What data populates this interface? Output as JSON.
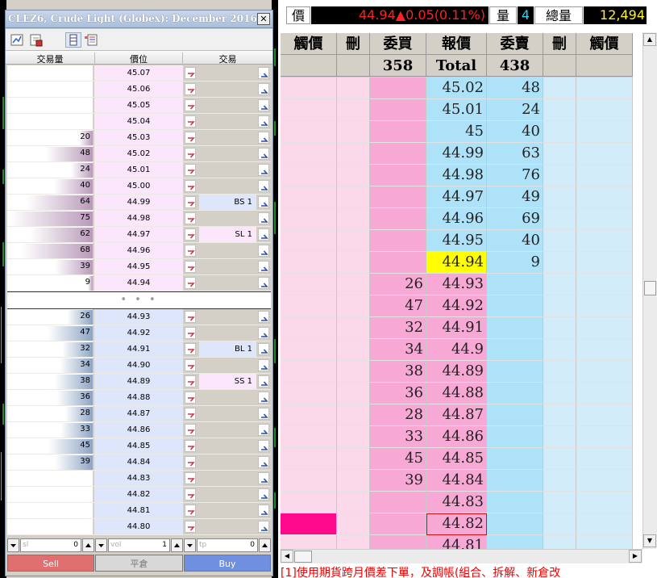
{
  "window": {
    "title": "CLEZ6, Crude Light (Globex): December 2016",
    "close_glyph": "✕"
  },
  "toolbar": {
    "icons": [
      "chart-icon",
      "depth-icon",
      "ladder-icon",
      "settings-list-icon"
    ],
    "active": "ladder-icon"
  },
  "columns": {
    "volume": "交易量",
    "price": "價位",
    "trade": "交易"
  },
  "ask_rows": [
    {
      "price": "45.07",
      "volume": "",
      "volume_bar": 0,
      "trade": ""
    },
    {
      "price": "45.06",
      "volume": "",
      "volume_bar": 0,
      "trade": ""
    },
    {
      "price": "45.05",
      "volume": "",
      "volume_bar": 0,
      "trade": ""
    },
    {
      "price": "45.04",
      "volume": "",
      "volume_bar": 0,
      "trade": ""
    },
    {
      "price": "45.03",
      "volume": "20",
      "volume_bar": 0.16,
      "trade": ""
    },
    {
      "price": "45.02",
      "volume": "48",
      "volume_bar": 0.55,
      "trade": ""
    },
    {
      "price": "45.01",
      "volume": "24",
      "volume_bar": 0.25,
      "trade": ""
    },
    {
      "price": "45.00",
      "volume": "40",
      "volume_bar": 0.45,
      "trade": ""
    },
    {
      "price": "44.99",
      "volume": "64",
      "volume_bar": 0.77,
      "trade": "BS 1"
    },
    {
      "price": "44.98",
      "volume": "75",
      "volume_bar": 0.96,
      "trade": ""
    },
    {
      "price": "44.97",
      "volume": "62",
      "volume_bar": 0.74,
      "trade": "SL 1"
    },
    {
      "price": "44.96",
      "volume": "68",
      "volume_bar": 0.83,
      "trade": ""
    },
    {
      "price": "44.95",
      "volume": "39",
      "volume_bar": 0.44,
      "trade": ""
    },
    {
      "price": "44.94",
      "volume": "9",
      "volume_bar": 0.06,
      "trade": ""
    }
  ],
  "separator": "• • •",
  "bid_rows": [
    {
      "price": "44.93",
      "volume": "26",
      "volume_bar": 0.3,
      "trade": ""
    },
    {
      "price": "44.92",
      "volume": "47",
      "volume_bar": 0.53,
      "trade": ""
    },
    {
      "price": "44.91",
      "volume": "32",
      "volume_bar": 0.36,
      "trade": "BL 1"
    },
    {
      "price": "44.90",
      "volume": "34",
      "volume_bar": 0.39,
      "trade": ""
    },
    {
      "price": "44.89",
      "volume": "38",
      "volume_bar": 0.44,
      "trade": "SS 1"
    },
    {
      "price": "44.88",
      "volume": "36",
      "volume_bar": 0.42,
      "trade": ""
    },
    {
      "price": "44.87",
      "volume": "28",
      "volume_bar": 0.32,
      "trade": ""
    },
    {
      "price": "44.86",
      "volume": "33",
      "volume_bar": 0.38,
      "trade": ""
    },
    {
      "price": "44.85",
      "volume": "45",
      "volume_bar": 0.52,
      "trade": ""
    },
    {
      "price": "44.84",
      "volume": "39",
      "volume_bar": 0.44,
      "trade": ""
    },
    {
      "price": "44.83",
      "volume": "",
      "volume_bar": 0,
      "trade": ""
    },
    {
      "price": "44.82",
      "volume": "",
      "volume_bar": 0,
      "trade": ""
    },
    {
      "price": "44.81",
      "volume": "",
      "volume_bar": 0,
      "trade": ""
    },
    {
      "price": "44.80",
      "volume": "",
      "volume_bar": 0,
      "trade": ""
    }
  ],
  "inputs": {
    "sl": {
      "placeholder": "sl",
      "value": "0"
    },
    "vol": {
      "placeholder": "vol",
      "value": "1"
    },
    "tp": {
      "placeholder": "tp",
      "value": "0"
    }
  },
  "buttons": {
    "sell": "Sell",
    "close": "平倉",
    "buy": "Buy"
  },
  "quote": {
    "price_label": "價",
    "price_change": "44.94▲0.05(0.11%)",
    "qty_label": "量",
    "qty": "4",
    "total_label": "總量",
    "total": "12,494"
  },
  "grid_headers": {
    "row1": [
      "觸價",
      "刪",
      "委買",
      "報價",
      "委賣",
      "刪",
      "觸價"
    ],
    "bid_total": "358",
    "total_label": "Total",
    "ask_total": "438"
  },
  "grid_rows": [
    {
      "bid": "",
      "price": "45.02",
      "ask": "48"
    },
    {
      "bid": "",
      "price": "45.01",
      "ask": "24"
    },
    {
      "bid": "",
      "price": "45",
      "ask": "40"
    },
    {
      "bid": "",
      "price": "44.99",
      "ask": "63"
    },
    {
      "bid": "",
      "price": "44.98",
      "ask": "76"
    },
    {
      "bid": "",
      "price": "44.97",
      "ask": "49"
    },
    {
      "bid": "",
      "price": "44.96",
      "ask": "69"
    },
    {
      "bid": "",
      "price": "44.95",
      "ask": "40"
    },
    {
      "bid": "",
      "price": "44.94",
      "ask": "9"
    },
    {
      "bid": "26",
      "price": "44.93",
      "ask": ""
    },
    {
      "bid": "47",
      "price": "44.92",
      "ask": ""
    },
    {
      "bid": "32",
      "price": "44.91",
      "ask": ""
    },
    {
      "bid": "34",
      "price": "44.9",
      "ask": ""
    },
    {
      "bid": "38",
      "price": "44.89",
      "ask": ""
    },
    {
      "bid": "36",
      "price": "44.88",
      "ask": ""
    },
    {
      "bid": "28",
      "price": "44.87",
      "ask": ""
    },
    {
      "bid": "33",
      "price": "44.86",
      "ask": ""
    },
    {
      "bid": "45",
      "price": "44.85",
      "ask": ""
    },
    {
      "bid": "39",
      "price": "44.84",
      "ask": ""
    },
    {
      "bid": "",
      "price": "44.83",
      "ask": ""
    },
    {
      "bid": "",
      "price": "44.82",
      "ask": ""
    },
    {
      "bid": "",
      "price": "44.81",
      "ask": ""
    }
  ],
  "highlight_price": "44.94",
  "selected_price": "44.82",
  "bottom_message": "[1]使用期貨跨月價差下單，及調帳(組合、拆解、新倉改",
  "colors": {
    "ask_price_bg": "#fbe6fb",
    "bid_price_bg": "#dde6fa",
    "ask_bar": "#b99ab9",
    "bid_bar": "#8ea4c4",
    "grid_pink": "#fbd9ea",
    "grid_pink_strong": "#f7a8d4",
    "grid_blue": "#aee2f8",
    "grid_blue_light": "#d2ecf9",
    "highlight": "#ffff00",
    "sell": "#e07070",
    "buy": "#6f8fe0",
    "quote_red": "#ff0000"
  }
}
